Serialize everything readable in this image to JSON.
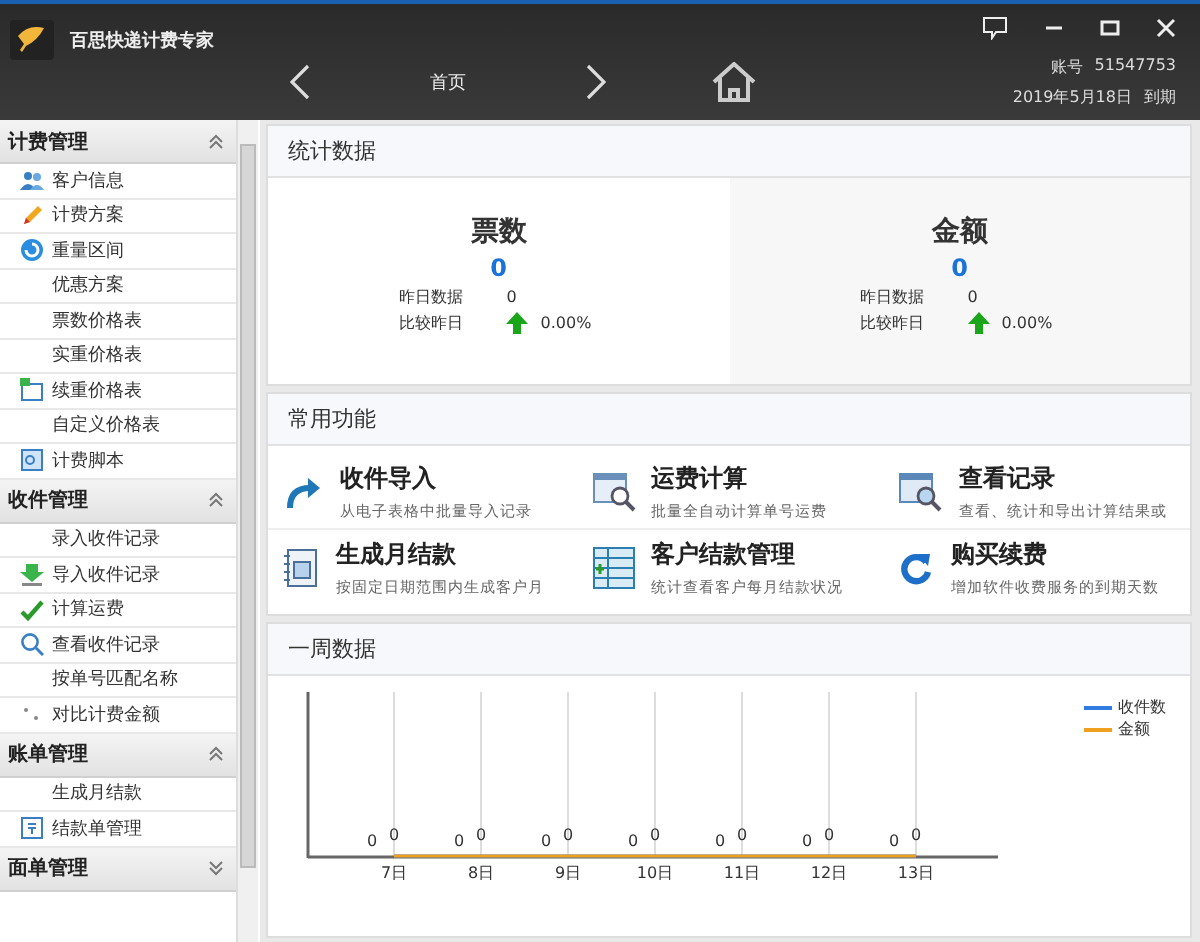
{
  "window": {
    "title": "百思快递计费专家",
    "account_label": "账号",
    "account": "51547753",
    "expiry": "2019年5月18日",
    "expiry_label": "到期"
  },
  "nav": {
    "current": "首页"
  },
  "sidebar": {
    "sections": [
      {
        "title": "计费管理",
        "expanded": true,
        "items": [
          {
            "label": "客户信息",
            "kind": "people"
          },
          {
            "label": "计费方案",
            "kind": "pencil"
          },
          {
            "label": "重量区间",
            "kind": "refresh"
          },
          {
            "label": "优惠方案",
            "kind": "plain"
          },
          {
            "label": "票数价格表",
            "kind": "plain"
          },
          {
            "label": "实重价格表",
            "kind": "plain"
          },
          {
            "label": "续重价格表",
            "kind": "sheet"
          },
          {
            "label": "自定义价格表",
            "kind": "plain"
          },
          {
            "label": "计费脚本",
            "kind": "script"
          }
        ]
      },
      {
        "title": "收件管理",
        "expanded": true,
        "items": [
          {
            "label": "录入收件记录",
            "kind": "plain"
          },
          {
            "label": "导入收件记录",
            "kind": "import"
          },
          {
            "label": "计算运费",
            "kind": "check"
          },
          {
            "label": "查看收件记录",
            "kind": "search"
          },
          {
            "label": "按单号匹配名称",
            "kind": "plain"
          },
          {
            "label": "对比计费金额",
            "kind": "dots"
          }
        ]
      },
      {
        "title": "账单管理",
        "expanded": true,
        "items": [
          {
            "label": "生成月结款",
            "kind": "plain"
          },
          {
            "label": "结款单管理",
            "kind": "list"
          }
        ]
      },
      {
        "title": "面单管理",
        "expanded": false
      }
    ]
  },
  "stats": {
    "title": "统计数据",
    "cards": [
      {
        "title": "票数",
        "value": "0",
        "yesterday_label": "昨日数据",
        "yesterday": "0",
        "compare_label": "比较昨日",
        "change": "0.00%"
      },
      {
        "title": "金额",
        "value": "0",
        "yesterday_label": "昨日数据",
        "yesterday": "0",
        "compare_label": "比较昨日",
        "change": "0.00%"
      }
    ]
  },
  "functions": {
    "title": "常用功能",
    "items": [
      {
        "title": "收件导入",
        "description": "从电子表格中批量导入记录",
        "kind": "arrow"
      },
      {
        "title": "运费计算",
        "description": "批量全自动计算单号运费",
        "kind": "calendar"
      },
      {
        "title": "查看记录",
        "description": "查看、统计和导出计算结果或",
        "kind": "window"
      },
      {
        "title": "生成月结款",
        "description": "按固定日期范围内生成客户月",
        "kind": "bill"
      },
      {
        "title": "客户结款管理",
        "description": "统计查看客户每月结款状况",
        "kind": "table"
      },
      {
        "title": "购买续费",
        "description": "增加软件收费服务的到期天数",
        "kind": "renew"
      }
    ]
  },
  "week": {
    "title": "一周数据",
    "days": [
      "7日",
      "8日",
      "9日",
      "10日",
      "11日",
      "12日",
      "13日"
    ],
    "series": [
      {
        "name": "收件数",
        "color": "#2f7be0",
        "point_labels": [
          "0",
          "0",
          "0",
          "0",
          "0",
          "0",
          "0"
        ]
      },
      {
        "name": "金额",
        "color": "#f0a020",
        "point_labels": [
          "0",
          "0",
          "0",
          "0",
          "0",
          "0",
          "0"
        ]
      }
    ]
  }
}
